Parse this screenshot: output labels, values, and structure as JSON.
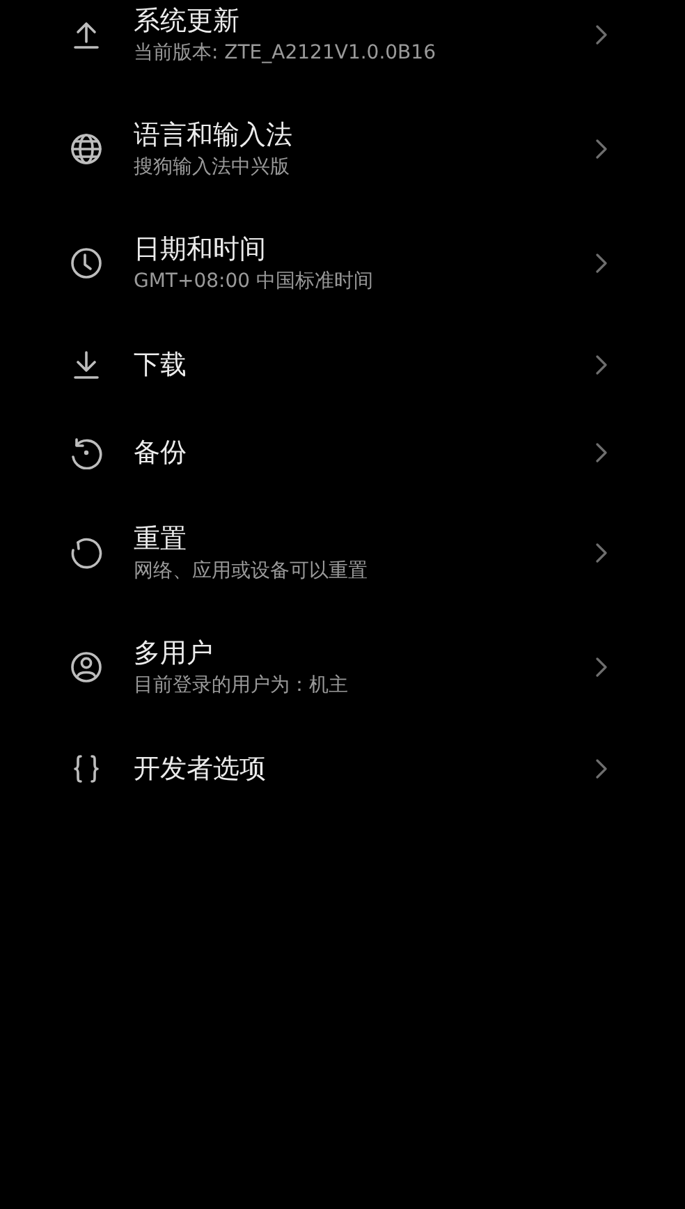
{
  "settings_items": [
    {
      "title": "系统更新",
      "subtitle": "当前版本: ZTE_A2121V1.0.0B16"
    },
    {
      "title": "语言和输入法",
      "subtitle": "搜狗输入法中兴版"
    },
    {
      "title": "日期和时间",
      "subtitle": "GMT+08:00 中国标准时间"
    },
    {
      "title": "下载"
    },
    {
      "title": "备份"
    },
    {
      "title": "重置",
      "subtitle": "网络、应用或设备可以重置"
    },
    {
      "title": "多用户",
      "subtitle": "目前登录的用户为：机主"
    },
    {
      "title": "开发者选项"
    }
  ]
}
